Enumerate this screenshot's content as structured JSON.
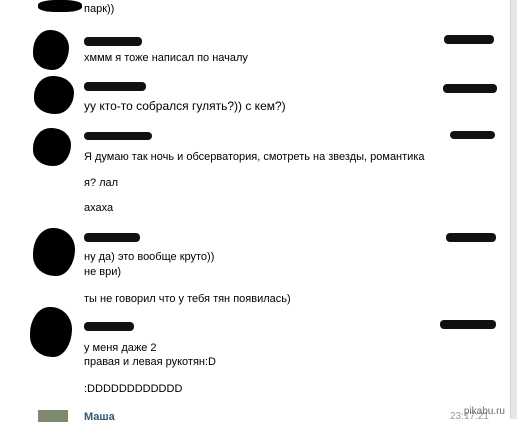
{
  "messages": [
    {
      "id": "m0",
      "lines": [
        "парк))"
      ]
    },
    {
      "id": "m1",
      "lines": [
        "хммм я тоже написал по началу"
      ]
    },
    {
      "id": "m2",
      "lines": [
        "уу кто-то собрался гулять?)) с кем?)"
      ]
    },
    {
      "id": "m3",
      "lines": [
        "Я думаю так ночь и обсерватория, смотреть на звезды, романтика",
        "я? лал",
        "ахаха"
      ]
    },
    {
      "id": "m4",
      "lines": [
        "ну да) это вообще круто))",
        "не ври)",
        "ты не говорил что у тебя тян появилась)"
      ]
    },
    {
      "id": "m5",
      "lines": [
        "у меня даже 2",
        "правая и левая рукотян:D",
        ":DDDDDDDDDDDD"
      ]
    }
  ],
  "bottom": {
    "name": "Маша",
    "time": "23:17:21"
  },
  "watermark": "pikabu.ru",
  "colors": {
    "name_link": "#2b587a",
    "time": "#999999",
    "redaction": "#000000"
  }
}
